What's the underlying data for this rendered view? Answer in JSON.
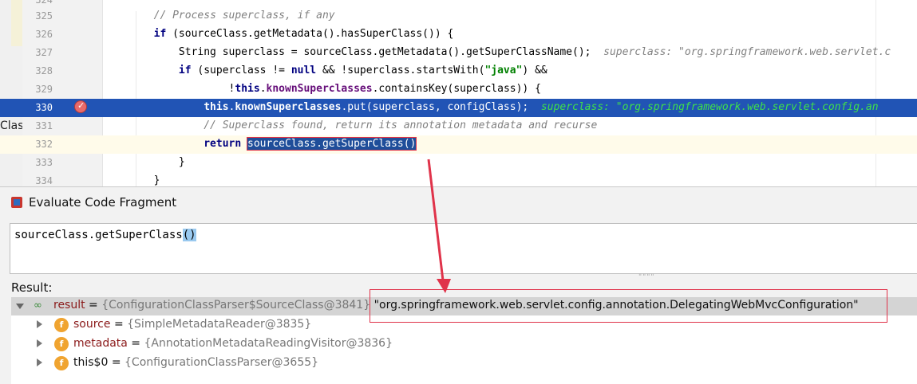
{
  "editor": {
    "left_fragment": "Class",
    "lines": [
      {
        "num": "324",
        "tokens": []
      },
      {
        "num": "325",
        "tokens": [
          {
            "t": "        "
          },
          {
            "t": "// Process superclass, if any",
            "c": "cm"
          }
        ]
      },
      {
        "num": "326",
        "tokens": [
          {
            "t": "        "
          },
          {
            "t": "if",
            "c": "kw"
          },
          {
            "t": " (sourceClass.getMetadata().hasSuperClass()) {"
          }
        ]
      },
      {
        "num": "327",
        "tokens": [
          {
            "t": "            String superclass = sourceClass.getMetadata().getSuperClassName();  "
          },
          {
            "t": "superclass: \"org.springframework.web.servlet.c",
            "c": "hint"
          }
        ]
      },
      {
        "num": "328",
        "tokens": [
          {
            "t": "            "
          },
          {
            "t": "if",
            "c": "kw"
          },
          {
            "t": " (superclass != "
          },
          {
            "t": "null",
            "c": "kw"
          },
          {
            "t": " && !superclass.startsWith("
          },
          {
            "t": "\"java\"",
            "c": "str"
          },
          {
            "t": ") &&"
          }
        ]
      },
      {
        "num": "329",
        "tokens": [
          {
            "t": "                    !"
          },
          {
            "t": "this",
            "c": "kw"
          },
          {
            "t": "."
          },
          {
            "t": "knownSuperclasses",
            "c": "fld"
          },
          {
            "t": ".containsKey(superclass)) {"
          }
        ]
      },
      {
        "num": "330",
        "tokens": [
          {
            "t": "                "
          },
          {
            "t": "this",
            "c": "kw"
          },
          {
            "t": "."
          },
          {
            "t": "knownSuperclasses",
            "c": "fld"
          },
          {
            "t": ".put(superclass, configClass);  "
          },
          {
            "t": "superclass: \"org.springframework.web.servlet.config.an",
            "c": "hint"
          }
        ]
      },
      {
        "num": "331",
        "tokens": [
          {
            "t": "                "
          },
          {
            "t": "// Superclass found, return its annotation metadata and recurse",
            "c": "cm"
          }
        ]
      },
      {
        "num": "332",
        "tokens": [
          {
            "t": "                "
          },
          {
            "t": "return",
            "c": "kw"
          },
          {
            "t": " "
          },
          {
            "t": "sourceClass.getSuperClass()",
            "c": "sel"
          }
        ]
      },
      {
        "num": "333",
        "tokens": [
          {
            "t": "            }"
          }
        ]
      },
      {
        "num": "334",
        "tokens": [
          {
            "t": "        }"
          }
        ]
      }
    ]
  },
  "dialog": {
    "title": "Evaluate Code Fragment",
    "expression_text": "sourceClass.getSuperClass",
    "expression_parens": "()",
    "result_label": "Result:",
    "resize_handle": "\"\"\"\"",
    "result": {
      "name": "result",
      "eq": " = ",
      "type": "{ConfigurationClassParser$SourceClass@3841}",
      "value": "\"org.springframework.web.servlet.config.annotation.DelegatingWebMvcConfiguration\""
    },
    "children": [
      {
        "icon": "f",
        "name": "source",
        "eq": " = ",
        "type": "{SimpleMetadataReader@3835}"
      },
      {
        "icon": "f",
        "name": "metadata",
        "eq": " = ",
        "type": "{AnnotationMetadataReadingVisitor@3836}"
      },
      {
        "icon": "f",
        "name": "this$0",
        "eq": " = ",
        "type": "{ConfigurationClassParser@3655}"
      }
    ]
  },
  "colors": {
    "highlight_line": "#2154b5",
    "annotation_red": "#e0334a",
    "breakpoint": "#e86a6a"
  }
}
